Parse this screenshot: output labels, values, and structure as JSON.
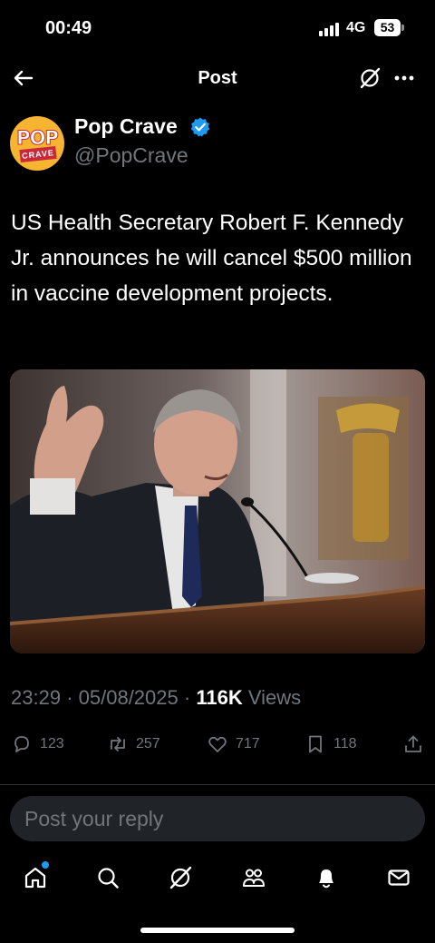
{
  "status_bar": {
    "time": "00:49",
    "network": "4G",
    "battery": "53"
  },
  "nav": {
    "title": "Post"
  },
  "author": {
    "display_name": "Pop Crave",
    "handle": "@PopCrave",
    "avatar_top": "POP",
    "avatar_bottom": "CRAVE",
    "verified_color": "#1d9bf0"
  },
  "tweet": {
    "text": "US Health Secretary Robert F. Kennedy Jr. announces he will cancel $500 million in vaccine development projects."
  },
  "meta": {
    "time": "23:29",
    "date": "05/08/2025",
    "views_count": "116K",
    "views_label": "Views"
  },
  "actions": {
    "replies": "123",
    "reposts": "257",
    "likes": "717",
    "bookmarks": "118"
  },
  "reply": {
    "placeholder": "Post your reply"
  },
  "icons": {
    "back": "arrow-left-icon",
    "grok": "grok-icon",
    "more": "more-dots-icon",
    "verified": "verified-badge-icon",
    "reply": "reply-bubble-icon",
    "repost": "repost-icon",
    "like": "heart-icon",
    "bookmark": "bookmark-icon",
    "share": "share-icon",
    "tabs": [
      "home-icon",
      "search-icon",
      "grok-icon",
      "communities-icon",
      "notifications-icon",
      "messages-icon"
    ]
  },
  "colors": {
    "background": "#000000",
    "muted": "#71767b",
    "accent": "#1d9bf0"
  }
}
